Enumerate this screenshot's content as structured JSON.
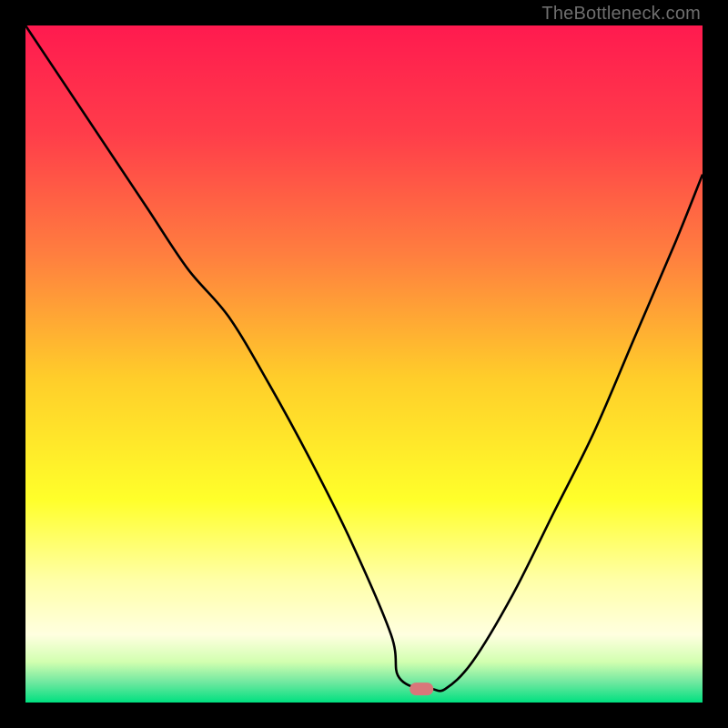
{
  "watermark": {
    "text": "TheBottleneck.com"
  },
  "chart_data": {
    "type": "line",
    "title": "",
    "xlabel": "",
    "ylabel": "",
    "xlim": [
      0,
      100
    ],
    "ylim": [
      0,
      100
    ],
    "series": [
      {
        "name": "curve",
        "x": [
          0,
          6,
          12,
          18,
          24,
          30,
          36,
          42,
          48,
          54,
          55,
          58,
          60,
          62,
          66,
          72,
          78,
          84,
          90,
          96,
          100
        ],
        "y": [
          100,
          91,
          82,
          73,
          64,
          57,
          47,
          36,
          24,
          10,
          4,
          2,
          2,
          2,
          6,
          16,
          28,
          40,
          54,
          68,
          78
        ]
      }
    ],
    "marker": {
      "x": 58.5,
      "y": 2
    },
    "gradient_stops": [
      {
        "pos": 0.0,
        "color": "#ff1a4f"
      },
      {
        "pos": 0.16,
        "color": "#ff3d4a"
      },
      {
        "pos": 0.34,
        "color": "#ff7f3f"
      },
      {
        "pos": 0.52,
        "color": "#ffcd2a"
      },
      {
        "pos": 0.7,
        "color": "#ffff2a"
      },
      {
        "pos": 0.82,
        "color": "#ffffa8"
      },
      {
        "pos": 0.9,
        "color": "#ffffe0"
      },
      {
        "pos": 0.94,
        "color": "#d2ffb0"
      },
      {
        "pos": 0.97,
        "color": "#70e8a0"
      },
      {
        "pos": 1.0,
        "color": "#00e080"
      }
    ]
  }
}
